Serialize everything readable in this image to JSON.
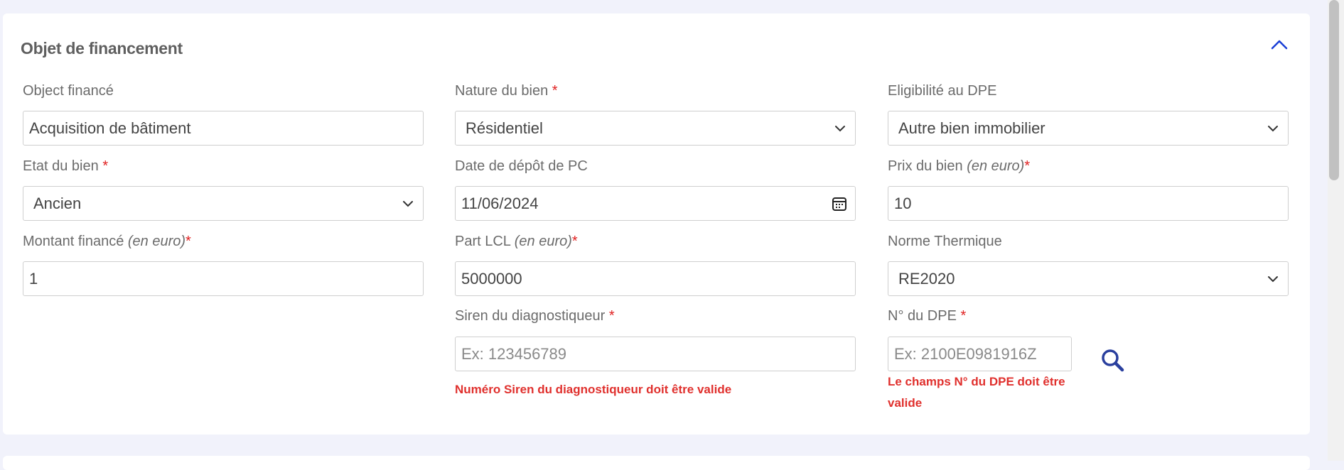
{
  "section": {
    "title": "Objet de financement"
  },
  "fields": {
    "object_finance": {
      "label": "Object financé",
      "value": "Acquisition de bâtiment"
    },
    "nature_bien": {
      "label": "Nature du bien",
      "value": "Résidentiel",
      "required": "*"
    },
    "eligibilite_dpe": {
      "label": "Eligibilité au DPE",
      "value": "Autre bien immobilier"
    },
    "etat_bien": {
      "label": "Etat du bien",
      "value": "Ancien",
      "required": "*"
    },
    "date_depot_pc": {
      "label": "Date de dépôt de PC",
      "value": "11/06/2024"
    },
    "prix_bien": {
      "label": "Prix du bien",
      "unit": "(en euro)",
      "value": "10",
      "required": "*"
    },
    "montant_finance": {
      "label": "Montant financé",
      "unit": "(en euro)",
      "value": "1",
      "required": "*"
    },
    "part_lcl": {
      "label": "Part LCL",
      "unit": "(en euro)",
      "value": "5000000",
      "required": "*"
    },
    "norme_thermique": {
      "label": "Norme Thermique",
      "value": "RE2020"
    },
    "siren_diag": {
      "label": "Siren du diagnostiqueur",
      "placeholder": "Ex: 123456789",
      "required": "*",
      "error": "Numéro Siren du diagnostiqueur doit être valide"
    },
    "num_dpe": {
      "label": "N° du DPE",
      "placeholder": "Ex: 2100E0981916Z",
      "required": "*",
      "error_line1": "Le champs N° du DPE doit être",
      "error_line2": "valide"
    }
  },
  "colors": {
    "accent": "#1a3fd6",
    "error": "#e0302d",
    "required": "#e02020"
  },
  "icons": {
    "collapse": "chevron-up-icon",
    "select": "chevron-down-icon",
    "date": "calendar-icon",
    "search": "search-icon"
  }
}
